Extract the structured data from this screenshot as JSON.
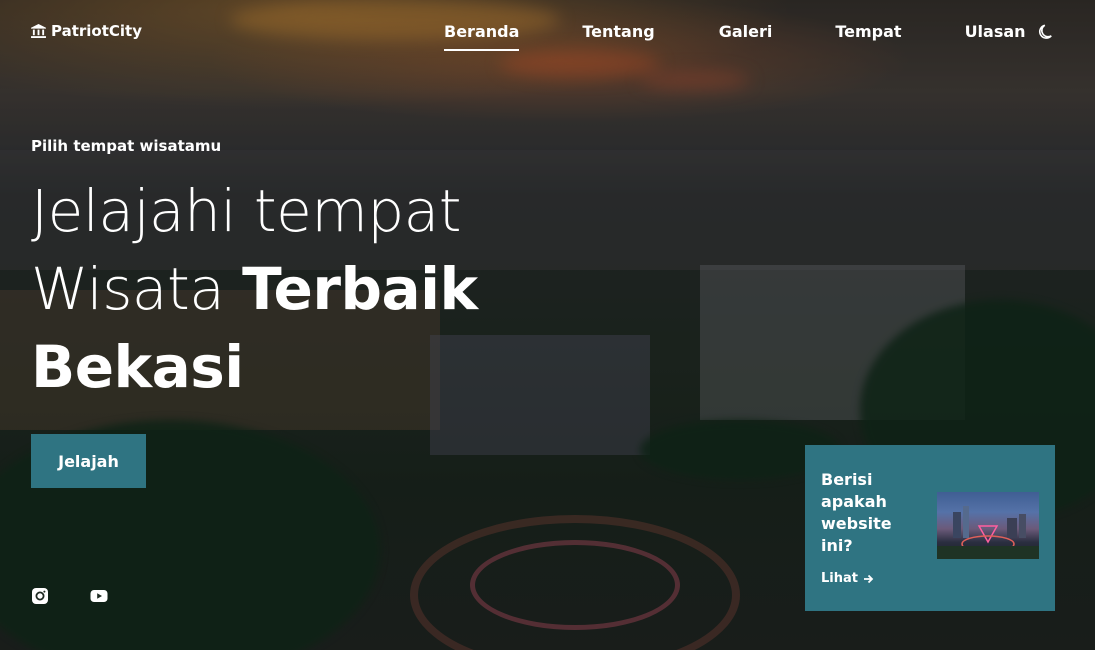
{
  "brand": {
    "name": "PatriotCity",
    "icon": "landmark-icon"
  },
  "nav": {
    "items": [
      {
        "label": "Beranda",
        "active": true
      },
      {
        "label": "Tentang",
        "active": false
      },
      {
        "label": "Galeri",
        "active": false
      },
      {
        "label": "Tempat",
        "active": false
      },
      {
        "label": "Ulasan",
        "active": false
      }
    ],
    "theme_toggle_icon": "moon-icon"
  },
  "hero": {
    "eyebrow": "Pilih tempat wisatamu",
    "line1": "Jelajahi tempat",
    "line2_light": "Wisata",
    "line2_bold": "Terbaik",
    "line3_bold": "Bekasi",
    "cta_label": "Jelajah"
  },
  "social": [
    {
      "icon": "instagram-icon"
    },
    {
      "icon": "youtube-icon"
    }
  ],
  "info_card": {
    "title": "Berisi apakah website ini?",
    "link_label": "Lihat",
    "link_icon": "arrow-right-icon"
  },
  "colors": {
    "accent": "#2f7482",
    "text": "#ffffff"
  }
}
